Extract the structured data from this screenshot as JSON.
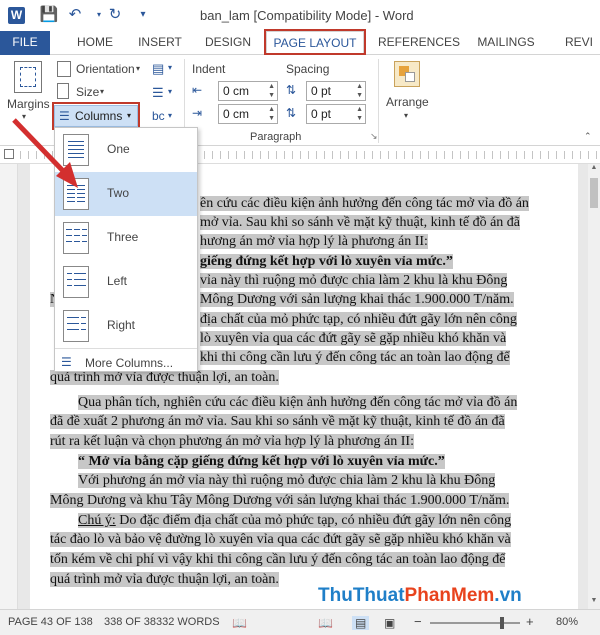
{
  "titlebar": {
    "title": "ban_lam [Compatibility Mode] - Word",
    "app_icon": "W"
  },
  "tabs": [
    "FILE",
    "HOME",
    "INSERT",
    "DESIGN",
    "PAGE LAYOUT",
    "REFERENCES",
    "MAILINGS",
    "REVI"
  ],
  "ribbon": {
    "margins": "Margins",
    "orientation": "Orientation",
    "size": "Size",
    "columns": "Columns",
    "indent_label": "Indent",
    "spacing_label": "Spacing",
    "indent_left": "0 cm",
    "indent_right": "0 cm",
    "spacing_before": "0 pt",
    "spacing_after": "0 pt",
    "paragraph_group": "Paragraph",
    "arrange": "Arrange"
  },
  "columns_menu": {
    "items": [
      "One",
      "Two",
      "Three",
      "Left",
      "Right"
    ],
    "highlighted": "Two",
    "more": "More Columns..."
  },
  "document": {
    "p1a": "ên cứu các điều kiện ảnh hưởng đến công tác mở vỉa đồ án",
    "p1b": "mở vỉa. Sau khi so sánh về mặt kỹ thuật, kinh tế đồ án đã",
    "p1c": "hương án mở vỉa hợp lý là phương án II:",
    "p2": "giếng đứng kết hợp với lò xuyên vỉa mức.”",
    "p3a": "vỉa này thì ruộng mỏ được chia làm 2 khu là khu Đông",
    "p3b": "N",
    "p3c": "Mông Dương với sản lượng khai thác 1.900.000 T/năm.",
    "p4a": "địa chất của mỏ phức tạp, có nhiều đứt gãy lớn nên công",
    "p4b": "lò xuyên vỉa qua các đứt gãy sẽ gặp nhiều khó khăn và",
    "p4c": "khi thi công cần lưu ý đến công tác an toàn lao động để",
    "p4d": "quá trình mở vỉa được thuận lợi, an toàn.",
    "p5a": "Qua phân tích, nghiên cứu các điều kiện ảnh hưởng đến công tác mở vỉa đồ án",
    "p5b": "đã đề xuất 2 phương án mở vỉa. Sau khi so sánh về mặt kỹ thuật, kinh tế đồ án đã",
    "p5c": "rút ra kết luận và chọn phương án mở vỉa hợp lý là phương án II:",
    "p6": "“ Mở vỉa bằng cặp giếng đứng kết hợp với lò xuyên vỉa mức.”",
    "p7a": "Với phương án mở vỉa này thì ruộng mỏ được chia làm 2 khu là khu Đông",
    "p7b": "Mông Dương và khu Tây Mông Dương với sản lượng khai thác 1.900.000 T/năm.",
    "p8_label": "Chú ý:",
    "p8a": " Do đặc điểm địa chất của mỏ phức tạp, có nhiều đứt gãy lớn nên công",
    "p8b": "tác đào lò và bảo vệ đường lò xuyên vỉa qua các đứt gãy sẽ gặp nhiều khó khăn và",
    "p8c": "tốn kém về chi phí vì vậy khi thi công cần lưu ý đến công tác an toàn lao động để",
    "p8d": "quá trình mở vỉa được thuận lợi, an toàn."
  },
  "status": {
    "page": "PAGE 43 OF 138",
    "words": "338 OF 38332 WORDS",
    "zoom": "80%"
  },
  "watermark": {
    "part1": "Thu",
    "part2": "Thuat",
    "part3": "PhanMem",
    "part4": ".vn"
  },
  "colors": {
    "accent": "#2b579a",
    "highlight_box": "#c0392b",
    "menu_hover": "#cde0f5",
    "selection": "#c7c7c7"
  }
}
